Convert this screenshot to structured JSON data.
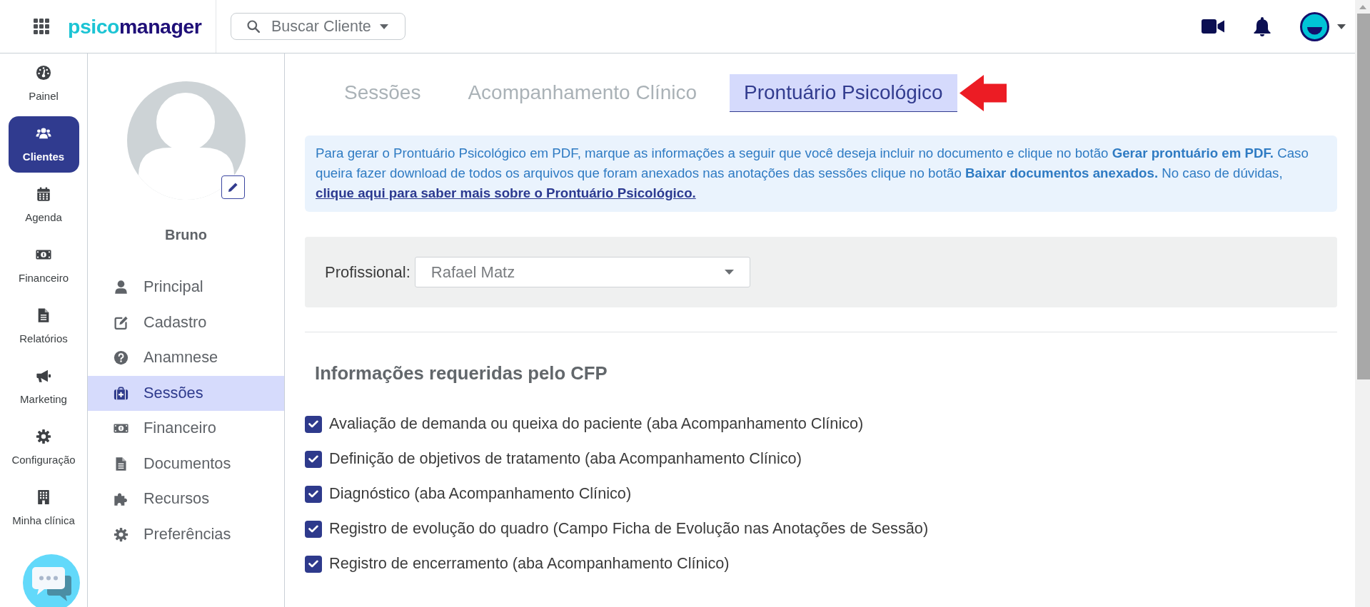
{
  "top_bar": {
    "logo": {
      "part_1": "psico",
      "part_2": "manager"
    },
    "search": {
      "placeholder": "Buscar Cliente"
    }
  },
  "nav_rail": {
    "items": [
      {
        "label": "Painel",
        "selected": false
      },
      {
        "label": "Clientes",
        "selected": true
      },
      {
        "label": "Agenda",
        "selected": false
      },
      {
        "label": "Financeiro",
        "selected": false
      },
      {
        "label": "Relatórios",
        "selected": false
      },
      {
        "label": "Marketing",
        "selected": false
      },
      {
        "label": "Configuração",
        "selected": false
      },
      {
        "label": "Minha clínica",
        "selected": false
      }
    ]
  },
  "client_panel": {
    "name": "Bruno",
    "menu": [
      {
        "label": "Principal",
        "selected": false
      },
      {
        "label": "Cadastro",
        "selected": false
      },
      {
        "label": "Anamnese",
        "selected": false
      },
      {
        "label": "Sessões",
        "selected": true
      },
      {
        "label": "Financeiro",
        "selected": false
      },
      {
        "label": "Documentos",
        "selected": false
      },
      {
        "label": "Recursos",
        "selected": false
      },
      {
        "label": "Preferências",
        "selected": false
      }
    ]
  },
  "tabs": [
    {
      "label": "Sessões",
      "selected": false
    },
    {
      "label": "Acompanhamento Clínico",
      "selected": false
    },
    {
      "label": "Prontuário Psicológico",
      "selected": true
    }
  ],
  "info_box": {
    "text": "Para gerar o Prontuário Psicológico em PDF, marque as informações a seguir que você deseja incluir no documento e clique no botão **Gerar prontuário em PDF.** Caso queira fazer download de todos os arquivos que foram anexados nas anotações das sessões clique no botão **Baixar documentos anexados.** No caso de dúvidas,",
    "link": "clique aqui para saber mais sobre o Prontuário Psicológico."
  },
  "filter": {
    "label": "Profissional:",
    "value": "Rafael Matz"
  },
  "section": {
    "title": "Informações requeridas pelo CFP",
    "options": [
      {
        "label": "Avaliação de demanda ou queixa do paciente (aba Acompanhamento Clínico)",
        "checked": true
      },
      {
        "label": "Definição de objetivos de tratamento (aba Acompanhamento Clínico)",
        "checked": true
      },
      {
        "label": "Diagnóstico (aba Acompanhamento Clínico)",
        "checked": true
      },
      {
        "label": "Registro de evolução do quadro (Campo Ficha de Evolução nas Anotações de Sessão)",
        "checked": true
      },
      {
        "label": "Registro de encerramento (aba Acompanhamento Clínico)",
        "checked": true
      }
    ]
  }
}
